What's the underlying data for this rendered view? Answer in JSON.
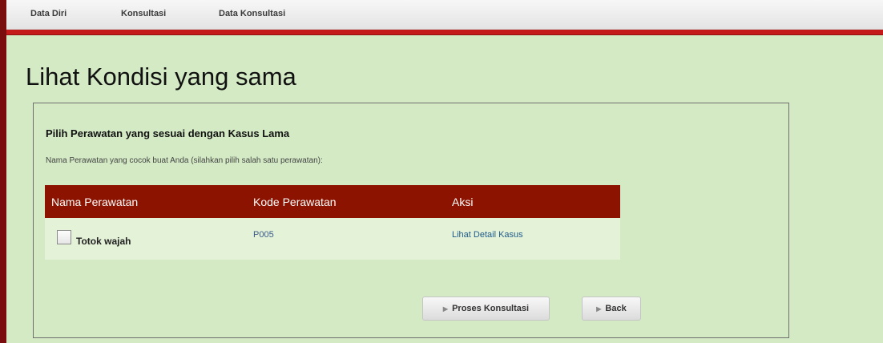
{
  "nav": {
    "items": [
      {
        "label": "Data Diri"
      },
      {
        "label": "Konsultasi"
      },
      {
        "label": "Data Konsultasi"
      }
    ]
  },
  "page": {
    "title": "Lihat Kondisi yang sama"
  },
  "panel": {
    "heading": "Pilih Perawatan yang sesuai dengan Kasus Lama",
    "subtitle": "Nama Perawatan yang cocok buat Anda (silahkan pilih salah satu perawatan):",
    "table": {
      "headers": [
        "Nama Perawatan",
        "Kode Perawatan",
        "Aksi"
      ],
      "rows": [
        {
          "nama": "Totok wajah",
          "kode": "P005",
          "aksi": "Lihat Detail Kasus",
          "checked": false
        }
      ]
    },
    "buttons": {
      "proses": "Proses Konsultasi",
      "back": "Back"
    }
  },
  "colors": {
    "background": "#d3eac4",
    "accent_red": "#c41a1a",
    "table_header": "#8b1300",
    "table_row": "#e4f2d8"
  }
}
